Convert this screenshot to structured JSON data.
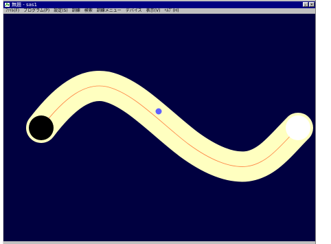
{
  "window": {
    "title": "無題 - sas1",
    "icon": "app-icon",
    "controls": [
      {
        "name": "minimize-button",
        "icon": "minimize-icon"
      },
      {
        "name": "close-button",
        "icon": "close-icon"
      }
    ]
  },
  "menu": {
    "items": [
      {
        "label": "ﾌｧｲﾙ(F)"
      },
      {
        "label": "プログラム(P)"
      },
      {
        "label": "設定(S)"
      },
      {
        "label": "訓練"
      },
      {
        "label": "検索"
      },
      {
        "label": "訓練メニュー"
      },
      {
        "label": "デバイス"
      },
      {
        "label": "表示(V)"
      },
      {
        "label": "ﾍﾙﾌﾟ(H)"
      }
    ]
  },
  "canvas": {
    "background": "#000040",
    "track_color": "#FFFFC0",
    "centerline_color": "#FF8040",
    "start_marker_color": "#000000",
    "end_marker_color": "#FFFFFF",
    "cursor_color": "#6060FF",
    "title_bar_color": "#000080",
    "chrome_color": "#C0C0C0"
  }
}
